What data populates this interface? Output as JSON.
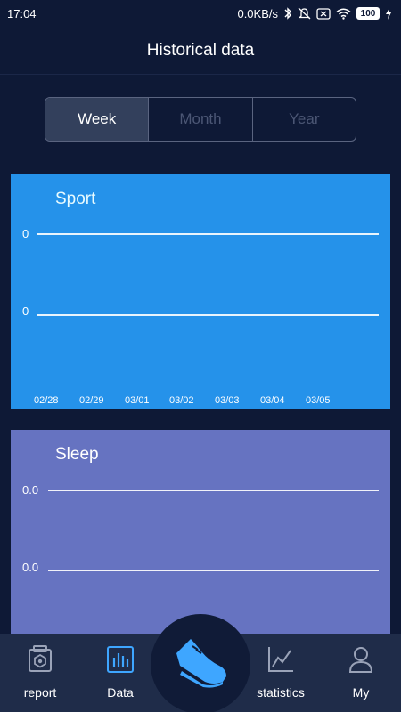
{
  "status_bar": {
    "time": "17:04",
    "network_speed": "0.0KB/s",
    "battery_level": "100",
    "icons": [
      "bluetooth-icon",
      "mute-icon",
      "sim-icon",
      "wifi-icon",
      "battery-icon",
      "charging-icon"
    ]
  },
  "header": {
    "title": "Historical data"
  },
  "segmented": {
    "options": [
      "Week",
      "Month",
      "Year"
    ],
    "selected": "Week"
  },
  "sport_card": {
    "title": "Sport",
    "y_labels": [
      "0",
      "0"
    ],
    "x_labels": [
      "02/28",
      "02/29",
      "03/01",
      "03/02",
      "03/03",
      "03/04",
      "03/05"
    ],
    "color": "#2592ea"
  },
  "sleep_card": {
    "title": "Sleep",
    "y_labels": [
      "0.0",
      "0.0"
    ],
    "color": "#6673c1"
  },
  "chart_data": [
    {
      "type": "line",
      "title": "Sport",
      "categories": [
        "02/28",
        "02/29",
        "03/01",
        "03/02",
        "03/03",
        "03/04",
        "03/05"
      ],
      "y_tick_labels": [
        "0",
        "0"
      ],
      "values": [],
      "grid": true
    },
    {
      "type": "line",
      "title": "Sleep",
      "y_tick_labels": [
        "0.0",
        "0.0"
      ],
      "values": [],
      "grid": true
    }
  ],
  "bottom_nav": {
    "items": [
      {
        "label": "report",
        "icon": "report-icon"
      },
      {
        "label": "Data",
        "icon": "bar-chart-icon",
        "active": true
      },
      {
        "label": "",
        "icon": "shoe-icon"
      },
      {
        "label": "statistics",
        "icon": "line-chart-icon"
      },
      {
        "label": "My",
        "icon": "person-icon"
      }
    ],
    "active_color": "#3ea6ff"
  }
}
